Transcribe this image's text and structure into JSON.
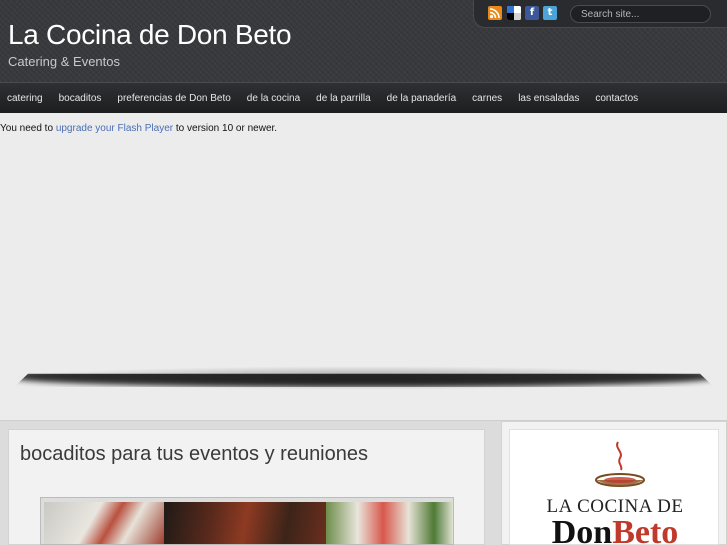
{
  "header": {
    "site_title": "La Cocina de Don Beto",
    "tagline": "Catering & Eventos",
    "search": {
      "placeholder": "Search site..."
    },
    "social_icons": [
      "rss-icon",
      "delicious-icon",
      "facebook-icon",
      "twitter-icon"
    ],
    "facebook_glyph": "f",
    "twitter_glyph": "t"
  },
  "nav": {
    "items": [
      "catering",
      "bocaditos",
      "preferencias de Don Beto",
      "de la cocina",
      "de la parrilla",
      "de la panadería",
      "carnes",
      "las ensaladas",
      "contactos"
    ]
  },
  "flash": {
    "prefix": "You need to",
    "link": "upgrade your Flash Player",
    "suffix": "to version 10 or newer."
  },
  "main": {
    "heading": "bocaditos para tus eventos y reuniones"
  },
  "logo": {
    "line1": "LA COCINA DE",
    "line2_a": "Don",
    "line2_b": "Beto"
  },
  "colors": {
    "header_bg": "#38393d",
    "nav_bg": "#1d1e20",
    "link": "#4a6fb5",
    "logo_accent": "#c0392b",
    "page_bg": "#ececec"
  }
}
